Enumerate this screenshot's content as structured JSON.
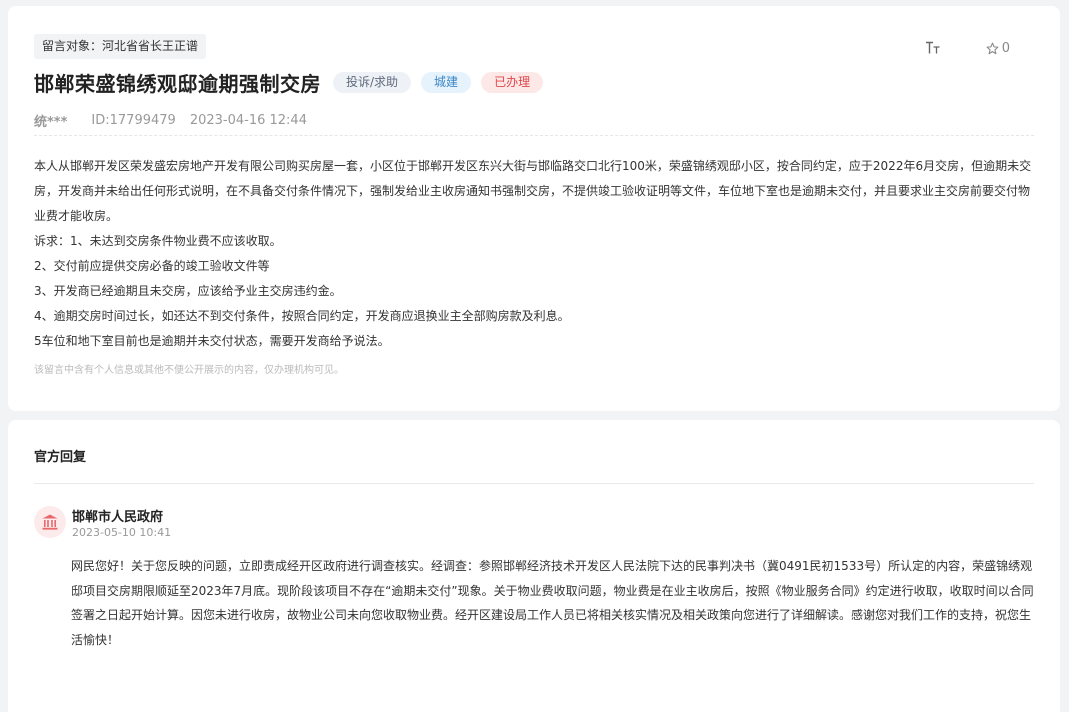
{
  "message": {
    "target": "留言对象：河北省省长王正谱",
    "title": "邯郸荣盛锦绣观邸逾期强制交房",
    "tags": {
      "type": "投诉/求助",
      "department": "城建",
      "status": "已办理"
    },
    "author": "统***",
    "id": "ID:17799479",
    "time": "2023-04-16 12:44",
    "favorite_count": "0",
    "font_size_icon": "font-size-icon",
    "star_icon": "star-icon",
    "paragraphs": [
      "本人从邯郸开发区荣发盛宏房地产开发有限公司购买房屋一套，小区位于邯郸开发区东兴大街与邯临路交口北行100米，荣盛锦绣观邸小区，按合同约定，应于2022年6月交房，但逾期未交房，开发商并未给出任何形式说明，在不具备交付条件情况下，强制发给业主收房通知书强制交房，不提供竣工验收证明等文件，车位地下室也是逾期未交付，并且要求业主交房前要交付物业费才能收房。",
      "诉求：1、未达到交房条件物业费不应该收取。",
      "2、交付前应提供交房必备的竣工验收文件等",
      "3、开发商已经逾期且未交房，应该给予业主交房违约金。",
      "4、逾期交房时间过长，如还达不到交付条件，按照合同约定，开发商应退换业主全部购房款及利息。",
      "5车位和地下室目前也是逾期并未交付状态，需要开发商给予说法。"
    ],
    "privacy_note": "该留言中含有个人信息或其他不便公开展示的内容，仅办理机构可见。"
  },
  "reply": {
    "section_title": "官方回复",
    "org_icon": "government-building-icon",
    "org_name": "邯郸市人民政府",
    "time": "2023-05-10 10:41",
    "content": "网民您好！关于您反映的问题，立即责成经开区政府进行调查核实。经调查：参照邯郸经济技术开发区人民法院下达的民事判决书（冀0491民初1533号）所认定的内容，荣盛锦绣观邸项目交房期限顺延至2023年7月底。现阶段该项目不存在“逾期未交付”现象。关于物业费收取问题，物业费是在业主收房后，按照《物业服务合同》约定进行收取，收取时间以合同签署之日起开始计算。因您未进行收房，故物业公司未向您收取物业费。经开区建设局工作人员已将相关核实情况及相关政策向您进行了详细解读。感谢您对我们工作的支持，祝您生活愉快！"
  },
  "colors": {
    "page_bg": "#f2f3f5",
    "status_red": "#e0474b",
    "department_blue": "#3e86c4",
    "org_icon_red": "#e8696c"
  }
}
